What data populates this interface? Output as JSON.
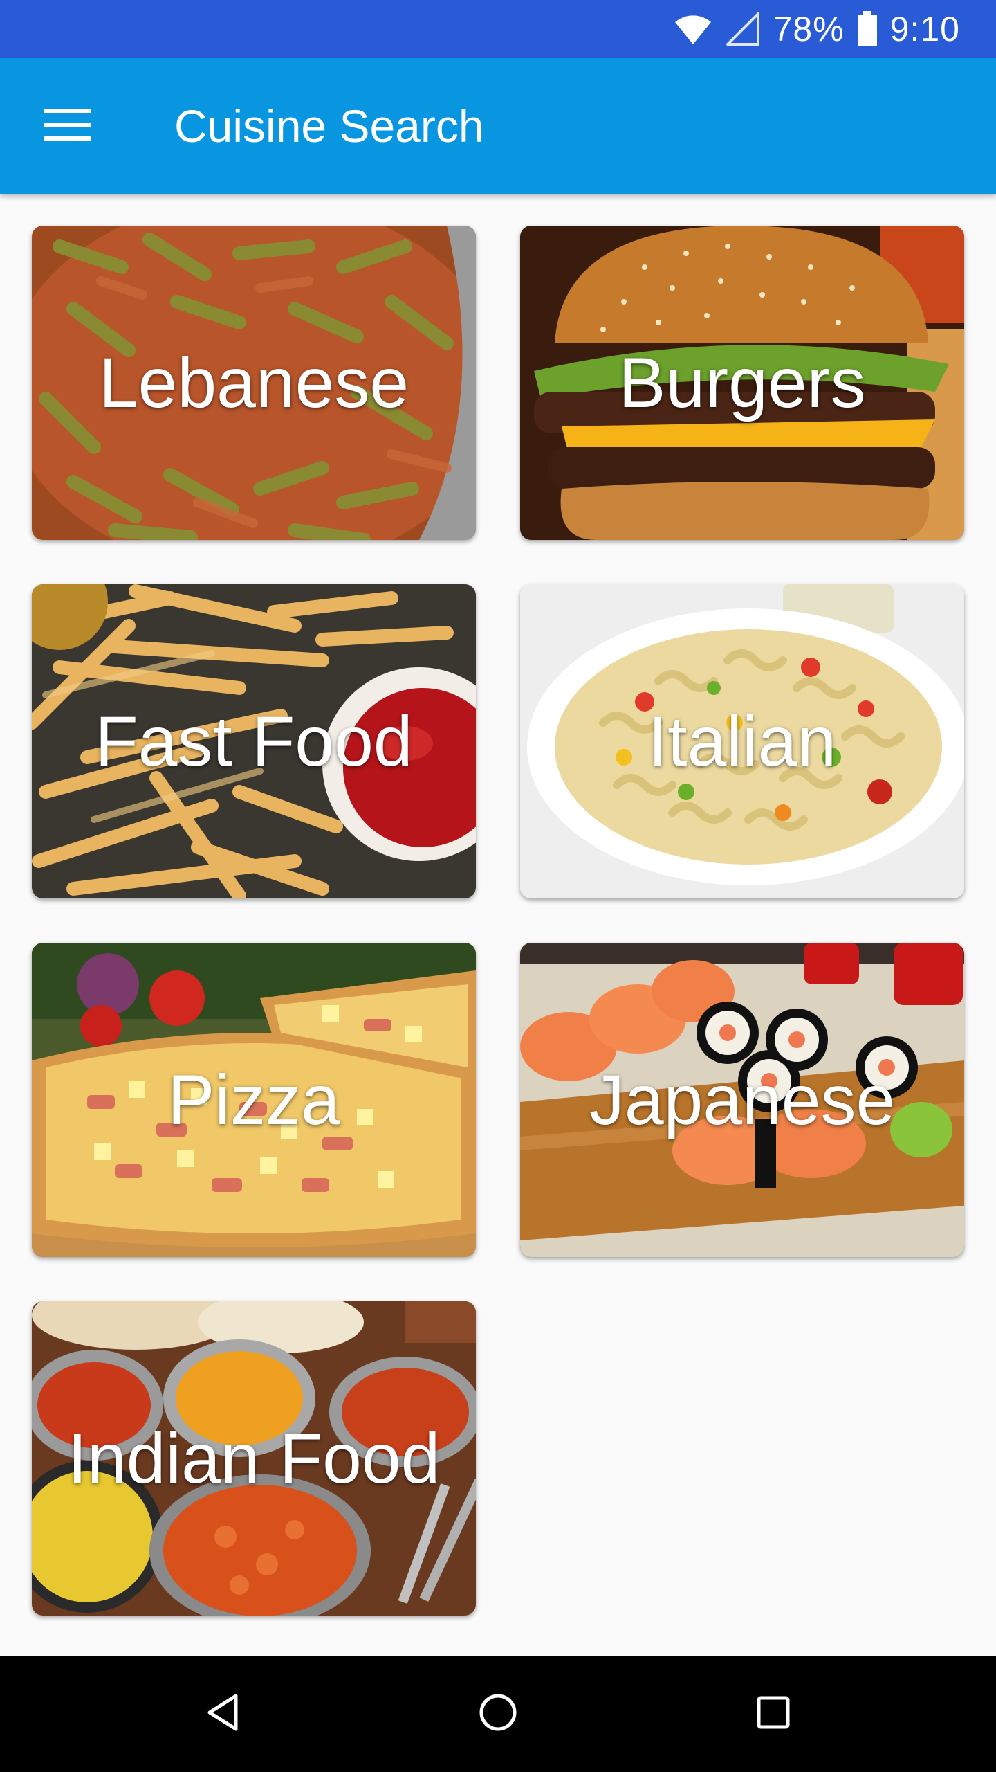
{
  "status_bar": {
    "icons": [
      "wifi-icon",
      "cell-signal-icon",
      "battery-icon"
    ],
    "battery": "78%",
    "time": "9:10",
    "background": "#2a5bd7"
  },
  "app_bar": {
    "title": "Cuisine Search",
    "menu_icon": "hamburger-menu-icon",
    "background": "#0896e0"
  },
  "cuisines": [
    {
      "id": "lebanese",
      "label": "Lebanese"
    },
    {
      "id": "burgers",
      "label": "Burgers"
    },
    {
      "id": "fast-food",
      "label": "Fast Food"
    },
    {
      "id": "italian",
      "label": "Italian"
    },
    {
      "id": "pizza",
      "label": "Pizza"
    },
    {
      "id": "japanese",
      "label": "Japanese"
    },
    {
      "id": "indian-food",
      "label": "Indian Food"
    }
  ],
  "nav_bar": {
    "buttons": [
      "back-icon",
      "home-icon",
      "recents-icon"
    ]
  }
}
